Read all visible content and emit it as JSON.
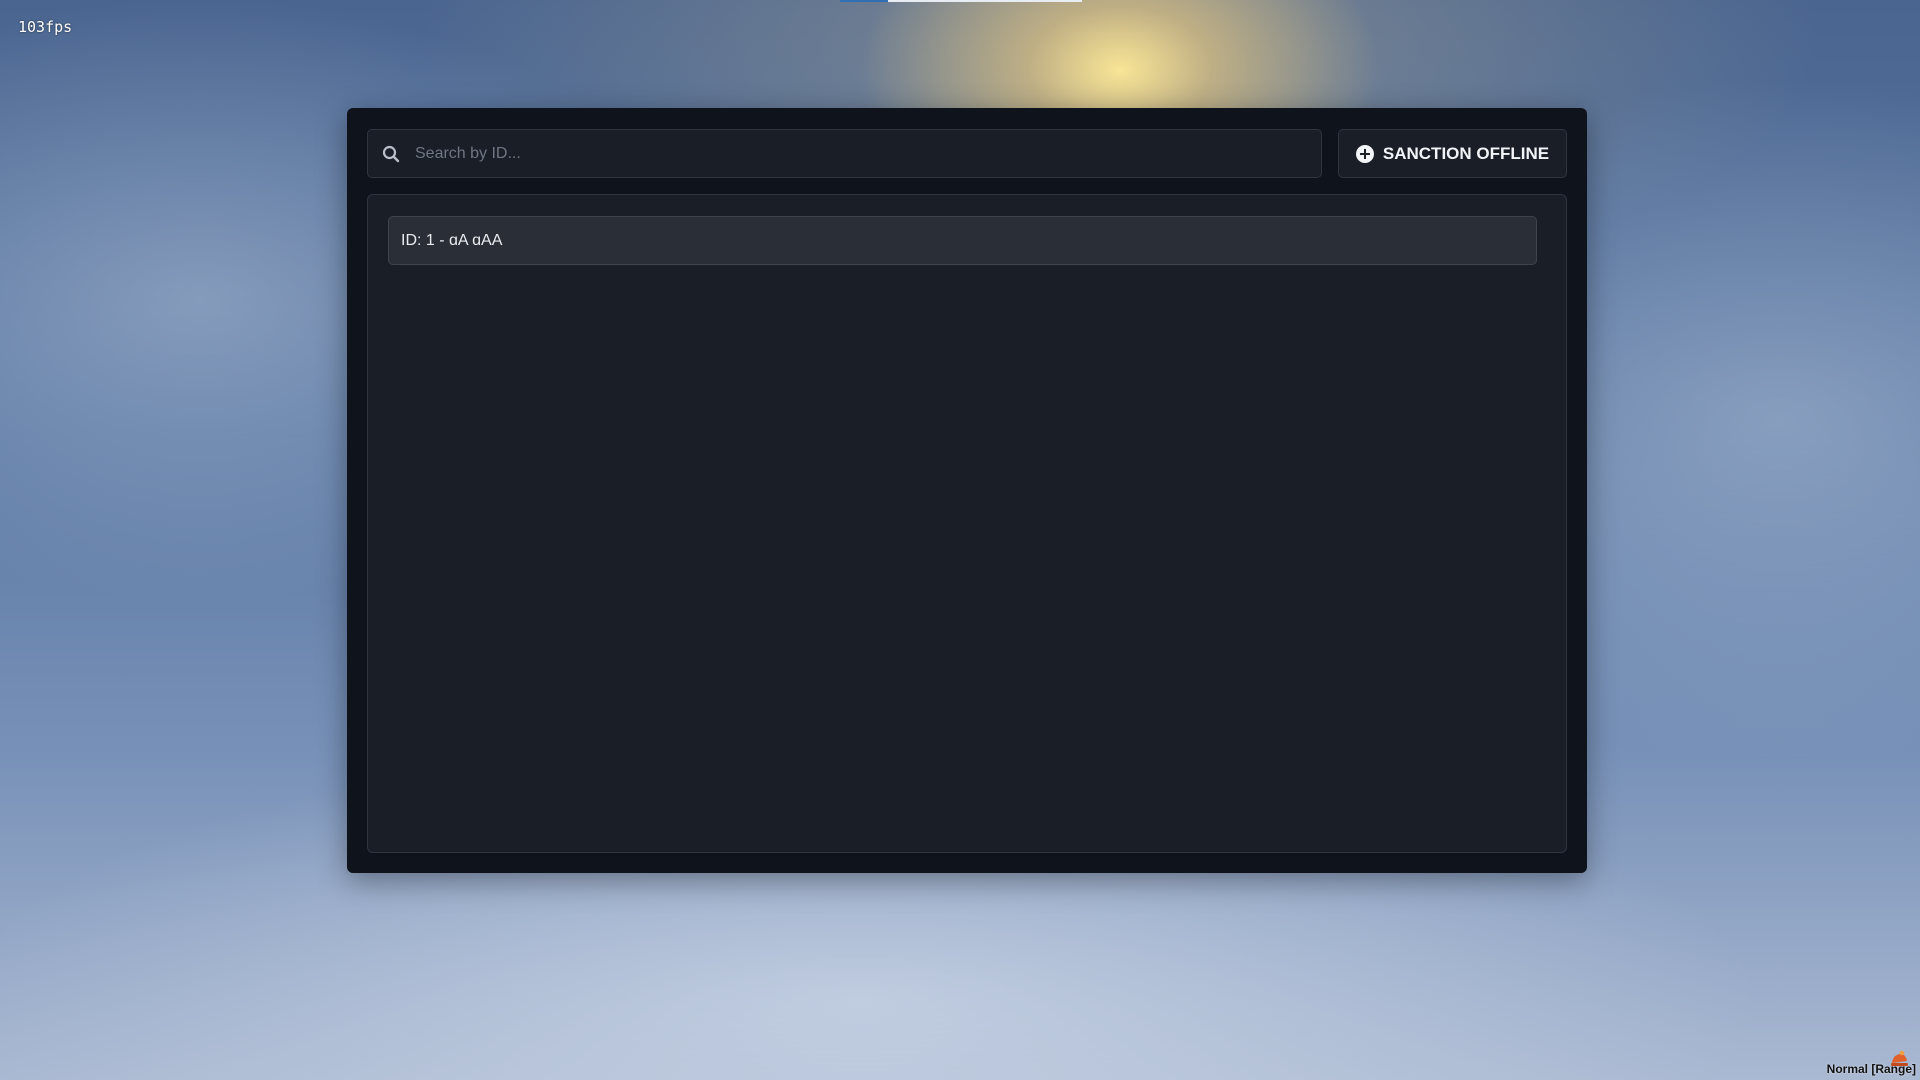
{
  "overlay": {
    "fps_counter": "103fps"
  },
  "search": {
    "placeholder": "Search by ID...",
    "value": ""
  },
  "toolbar": {
    "sanction_offline_label": "SANCTION OFFLINE",
    "sanction_icon": "plus-circle-icon"
  },
  "players": {
    "items": [
      {
        "label": "ID: 1 - ɑA ɑAA"
      }
    ]
  },
  "voice": {
    "mode_label": "Normal [Range]",
    "icon": "voice-range-icon"
  },
  "colors": {
    "panel_bg": "#0f141c",
    "input_bg": "#191e27",
    "item_bg": "#2a2e36",
    "border": "#2e3440",
    "text": "#f2f4f7"
  }
}
